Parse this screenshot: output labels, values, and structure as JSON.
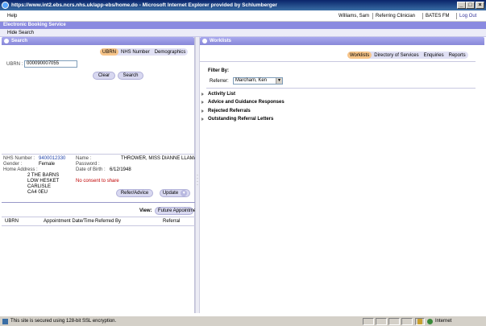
{
  "window": {
    "title": "https://www.int2.ebs.ncrs.nhs.uk/app-ebs/home.do - Microsoft Internet Explorer provided by Schlumberger",
    "minimize": "_",
    "maximize": "□",
    "close": "×"
  },
  "menubar": {
    "help": "Help",
    "user": "Williams, Sam",
    "role": "Referring Clinician",
    "site": "BATES FM",
    "logout": "Log Out"
  },
  "app": {
    "name": "Electronic Booking Service",
    "hide_search": "Hide Search"
  },
  "search": {
    "header": "Search",
    "tabs": [
      "UBRN",
      "NHS Number",
      "Demographics"
    ],
    "active_tab": "UBRN",
    "ubrn_label": "UBRN :",
    "ubrn_value": "000090007055",
    "clear_label": "Clear",
    "search_label": "Search"
  },
  "patient": {
    "nhs_number_label": "NHS Number :",
    "nhs_number": "9400012330",
    "gender_label": "Gender :",
    "gender": "Female",
    "address_label": "Home Address :",
    "address_lines": [
      "2 THE BARNS",
      "LOW HESKET",
      "CARLISLE",
      "CA4 0EU"
    ],
    "name_label": "Name :",
    "name": "THROWER, MISS DIANNE LLAMA",
    "password_label": "Password :",
    "password": "",
    "dob_label": "Date of Birth :",
    "dob": "6/12/1948",
    "consent": "No consent to share",
    "refer_label": "Refer/Advice",
    "update_label": "Update"
  },
  "appointments": {
    "view_label": "View:",
    "view_value": "Future Appointments",
    "columns": [
      "UBRN",
      "Appointment Date/Time",
      "Referred By",
      "Referral"
    ]
  },
  "worklists": {
    "header": "Worklists",
    "tabs": [
      "Worklists",
      "Directory of Services",
      "Enquiries",
      "Reports"
    ],
    "active_tab": "Worklists",
    "filter_title": "Filter By:",
    "referrer_label": "Referrer:",
    "referrer_value": "Marcham, Ken",
    "items": [
      "Activity List",
      "Advice and Guidance Responses",
      "Rejected Referrals",
      "Outstanding Referral Letters"
    ]
  },
  "statusbar": {
    "text": "This site is secured using 128-bit SSL encryption.",
    "zone": "Internet"
  },
  "colors": {
    "title_bar": "#0a246a",
    "panel_header": "#8888d8",
    "active_tab": "#f7c58a",
    "link": "#2244aa",
    "warning": "#c00000"
  }
}
